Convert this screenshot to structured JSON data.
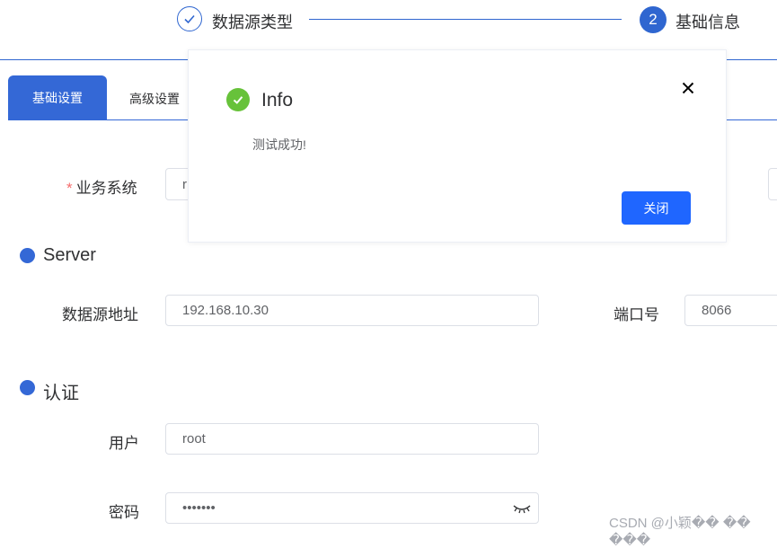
{
  "steps": {
    "step1_label": "数据源类型",
    "step2_number": "2",
    "step2_label": "基础信息"
  },
  "tabs": [
    {
      "label": "基础设置",
      "active": true
    },
    {
      "label": "高级设置",
      "active": false
    }
  ],
  "form": {
    "business_system": {
      "label": "业务系统",
      "required_mark": "*",
      "value": "r"
    },
    "server_section": "Server",
    "address": {
      "label": "数据源地址",
      "value": "192.168.10.30"
    },
    "port": {
      "label": "端口号",
      "value": "8066"
    },
    "auth_section": "认证",
    "user": {
      "label": "用户",
      "value": "root"
    },
    "password": {
      "label": "密码",
      "value": "•••••••"
    }
  },
  "dialog": {
    "title": "Info",
    "message": "测试成功!",
    "close_button": "关闭",
    "icon": "success-check-icon"
  },
  "watermark": "CSDN @小颖�� �� ���",
  "colors": {
    "primary": "#3468d6",
    "button": "#1f66ff",
    "success": "#67c23a",
    "required": "#f56c6c"
  }
}
